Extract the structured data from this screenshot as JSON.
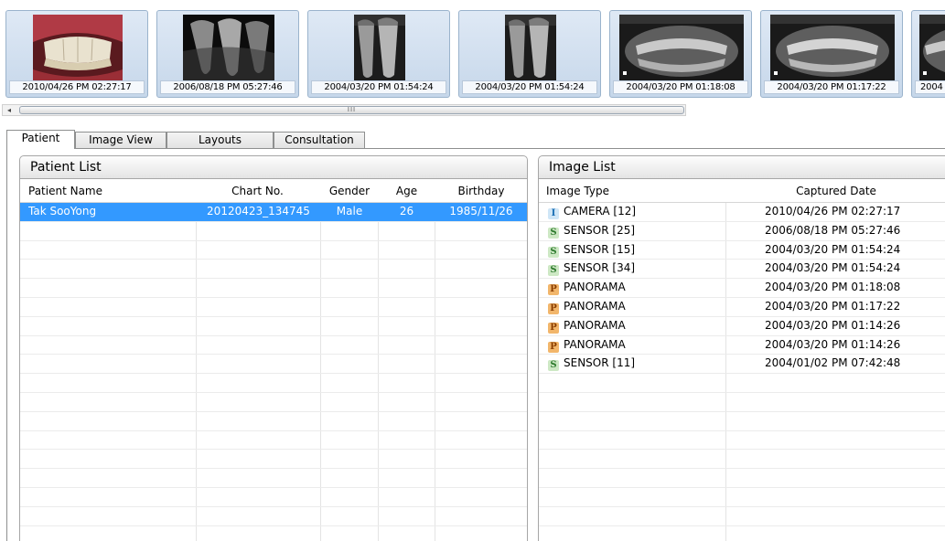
{
  "thumbnails": [
    {
      "label": "2010/04/26 PM 02:27:17",
      "kind": "camera"
    },
    {
      "label": "2006/08/18 PM 05:27:46",
      "kind": "sensor"
    },
    {
      "label": "2004/03/20 PM 01:54:24",
      "kind": "sensor-small"
    },
    {
      "label": "2004/03/20 PM 01:54:24",
      "kind": "sensor-small"
    },
    {
      "label": "2004/03/20 PM 01:18:08",
      "kind": "panorama"
    },
    {
      "label": "2004/03/20 PM 01:17:22",
      "kind": "panorama"
    },
    {
      "label": "2004",
      "kind": "panorama-partial"
    }
  ],
  "scrollbar": {
    "left_arrow": "◂",
    "grip": "III"
  },
  "tabs": [
    {
      "label": "Patient",
      "active": true
    },
    {
      "label": "Image View",
      "active": false
    },
    {
      "label": "Layouts",
      "active": false
    },
    {
      "label": "Consultation",
      "active": false
    }
  ],
  "patient_panel": {
    "title": "Patient List",
    "columns": [
      "Patient Name",
      "Chart No.",
      "Gender",
      "Age",
      "Birthday"
    ],
    "rows": [
      {
        "name": "Tak SooYong",
        "chart_no": "20120423_134745",
        "gender": "Male",
        "age": "26",
        "birthday": "1985/11/26",
        "selected": true
      }
    ]
  },
  "image_panel": {
    "title": "Image List",
    "columns": [
      "Image Type",
      "Captured Date"
    ],
    "rows": [
      {
        "badge": "I",
        "type": "CAMERA [12]",
        "date": "2010/04/26 PM 02:27:17"
      },
      {
        "badge": "S",
        "type": "SENSOR [25]",
        "date": "2006/08/18 PM 05:27:46"
      },
      {
        "badge": "S",
        "type": "SENSOR [15]",
        "date": "2004/03/20 PM 01:54:24"
      },
      {
        "badge": "S",
        "type": "SENSOR [34]",
        "date": "2004/03/20 PM 01:54:24"
      },
      {
        "badge": "P",
        "type": "PANORAMA",
        "date": "2004/03/20 PM 01:18:08"
      },
      {
        "badge": "P",
        "type": "PANORAMA",
        "date": "2004/03/20 PM 01:17:22"
      },
      {
        "badge": "P",
        "type": "PANORAMA",
        "date": "2004/03/20 PM 01:14:26"
      },
      {
        "badge": "P",
        "type": "PANORAMA",
        "date": "2004/03/20 PM 01:14:26"
      },
      {
        "badge": "S",
        "type": "SENSOR [11]",
        "date": "2004/01/02 PM 07:42:48"
      }
    ]
  },
  "badge_colors": {
    "I": {
      "bg": "#cfe6f7",
      "fg": "#1b6fb5"
    },
    "S": {
      "bg": "#cde8c4",
      "fg": "#2d7a2d"
    },
    "P": {
      "bg": "#f2b66b",
      "fg": "#8a3d00"
    }
  },
  "colors": {
    "selection": "#3399ff",
    "border": "#a6a6a6"
  }
}
